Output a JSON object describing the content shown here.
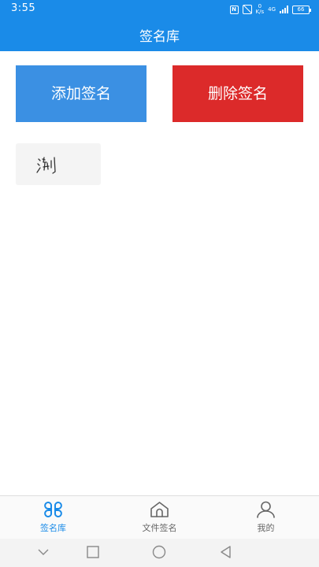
{
  "status_bar": {
    "time": "3:55",
    "speed": "0\nK/s",
    "network": "4G",
    "battery": "66"
  },
  "header": {
    "title": "签名库"
  },
  "actions": {
    "add_label": "添加签名",
    "delete_label": "删除签名"
  },
  "signatures": [
    {
      "text": "浏"
    }
  ],
  "tabbar": {
    "active_color": "#1a8be8",
    "inactive_color": "#666666",
    "items": [
      {
        "label": "签名库",
        "icon": "signature-library-icon",
        "active": true
      },
      {
        "label": "文件签名",
        "icon": "home-icon",
        "active": false
      },
      {
        "label": "我的",
        "icon": "person-icon",
        "active": false
      }
    ]
  },
  "colors": {
    "primary": "#1a8be8",
    "add_button": "#3b90e3",
    "delete_button": "#dc2a2a"
  },
  "system_nav": [
    "chevron-down-icon",
    "square-icon",
    "circle-icon",
    "back-triangle-icon"
  ]
}
